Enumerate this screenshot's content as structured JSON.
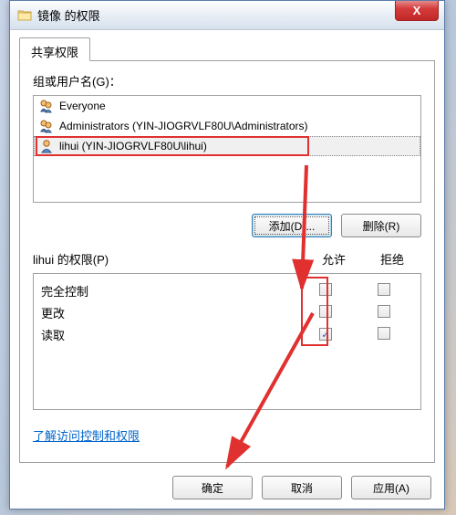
{
  "window": {
    "title": "镜像 的权限",
    "close_icon": "X"
  },
  "tab": {
    "label": "共享权限"
  },
  "group_label": "组或用户名(G)：",
  "users": [
    {
      "name": "Everyone",
      "type": "group"
    },
    {
      "name": "Administrators (YIN-JIOGRVLF80U\\Administrators)",
      "type": "group"
    },
    {
      "name": "lihui (YIN-JIOGRVLF80U\\lihui)",
      "type": "user"
    }
  ],
  "buttons": {
    "add": "添加(D)...",
    "remove": "删除(R)",
    "ok": "确定",
    "cancel": "取消",
    "apply": "应用(A)"
  },
  "perm_label": "lihui 的权限(P)",
  "cols": {
    "allow": "允许",
    "deny": "拒绝"
  },
  "perms": [
    {
      "name": "完全控制",
      "allow": false,
      "deny": false
    },
    {
      "name": "更改",
      "allow": false,
      "deny": false
    },
    {
      "name": "读取",
      "allow": true,
      "deny": false
    }
  ],
  "help_link": "了解访问控制和权限"
}
